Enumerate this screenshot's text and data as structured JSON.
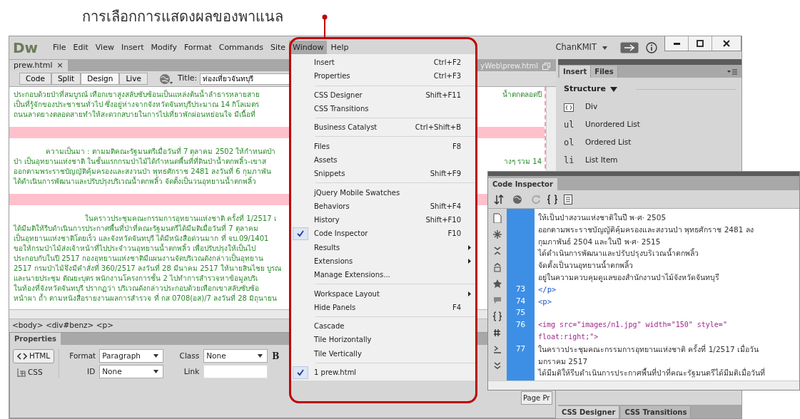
{
  "caption": "การเลือกการแสดงผลของพาแนล",
  "app": {
    "logo": "Dw",
    "user": "ChanKMIT",
    "menus": [
      {
        "label": "File",
        "selected": false
      },
      {
        "label": "Edit",
        "selected": false
      },
      {
        "label": "View",
        "selected": false
      },
      {
        "label": "Insert",
        "selected": false
      },
      {
        "label": "Modify",
        "selected": false
      },
      {
        "label": "Format",
        "selected": false
      },
      {
        "label": "Commands",
        "selected": false
      },
      {
        "label": "Site",
        "selected": false
      },
      {
        "label": "Window",
        "selected": true
      },
      {
        "label": "Help",
        "selected": false
      }
    ]
  },
  "document": {
    "tab": "prew.html",
    "tab_close": "×",
    "path": "yWeb\\prew.html",
    "views": [
      {
        "label": "Code",
        "selected": false
      },
      {
        "label": "Split",
        "selected": false
      },
      {
        "label": "Design",
        "selected": true
      },
      {
        "label": "Live",
        "selected": false
      }
    ],
    "title_label": "Title:",
    "title_value": "ท่องเที่ยวจันทบุรี"
  },
  "design_view": {
    "blocks": [
      {
        "kind": "paragraph",
        "lines": [
          {
            "kind": "plain",
            "text": "ประกอบด้วยป่าที่สมบูรณ์ เทือกเขาสูงสลับซับซ้อนเป็นแหล่งต้นน้ำลำธารหลายสาย",
            "right": "น้ำตกตลอดปี"
          },
          {
            "kind": "plain",
            "text": "เป็นที่รู้จักของประชาชนทั่วไป ซึ่งอยู่ห่างจากจังหวัดจันทบุรีประมาณ 14 กิโลเมตร"
          },
          {
            "kind": "plain",
            "text": "ถนนลาดยางตลอดสายทำให้สะดวกสบายในการไปเที่ยวพักผ่อนหย่อนใจ มีเนื้อที่"
          }
        ]
      },
      {
        "kind": "spacer"
      },
      {
        "kind": "paragraph",
        "lines": [
          {
            "kind": "indent",
            "text": "ความเป็นมา : ตามมติคณะรัฐมนตรีเมื่อวันที่ 7 ตุลาคม 2502 ให้กำหนดป่า"
          },
          {
            "kind": "plain",
            "text": "ป่า เป็นอุทยานแห่งชาติ ในชั้นแรกกรมป่าไม้ได้กำหนดพื้นที่ที่ดินป่าน้ำตกพลิ้ว-เขาส",
            "right": "างๆ รวม 14"
          },
          {
            "kind": "plain",
            "text": "ออกตามพระราชบัญญัติคุ้มครองและสงวนป่า พุทธศักราช 2481 ลงวันที่ 6 กุมภาพัน"
          },
          {
            "kind": "plain",
            "text": "ได้ดำเนินการพัฒนาและปรับปรุงบริเวณน้ำตกพลิ้ว จัดตั้งเป็นวนอุทยานน้ำตกพลิ้ว"
          }
        ]
      },
      {
        "kind": "spacer"
      },
      {
        "kind": "paragraph",
        "lines": [
          {
            "kind": "deep_indent",
            "text": "ในคราวประชุมคณะกรรมการอุทยานแห่งชาติ ครั้งที่ 1/2517 เ"
          },
          {
            "kind": "plain",
            "text": "ได้มีมติให้รีบดำเนินการประกาศพื้นที่ป่าที่คณะรัฐมนตรีได้มีมติเมื่อวันที่ 7 ตุลาคม"
          },
          {
            "kind": "plain",
            "text": "เป็นอุทยานแห่งชาติโดยเร็ว และจังหวัดจันทบุรี ได้มีหนังสือด่วนมาก ที่ จบ.09/1401"
          },
          {
            "kind": "plain",
            "text": "ขอให้กรมป่าไม้ส่งเจ้าหน้าที่ไปประจำวนอุทยานน้ำตกพลิ้ว เพื่อปรับปรุงให้เป็นไป"
          },
          {
            "kind": "plain",
            "text": "ประกอบกับในปี 2517 กองอุทยานแห่งชาติมีแผนงานจัดบริเวณดังกล่าวเป็นอุทยาน"
          },
          {
            "kind": "plain",
            "text": "2517 กรมป่าไม้จึงมีคำสั่งที่ 360/2517 ลงวันที่ 28 มีนาคม 2517 ให้นายสินไชย บูรณ"
          },
          {
            "kind": "plain",
            "text": "และนายประชุม ตัณยะบุตร พนักงานโครงการชั้น 2 ไปทำการสำรวจหาข้อมูลบริเ"
          },
          {
            "kind": "plain",
            "text": "ในท้องที่จังหวัดจันทบุรี ปรากฏว่า บริเวณดังกล่าวประกอบด้วยเทือกเขาสลับซับซ้อ"
          },
          {
            "kind": "plain",
            "text": "หน้าผา ถ้ำ ตามหนังสือรายงานผลการสำรวจ ที่ กส 0708(อส)/7 ลงวันที่ 28 มิถุนายน"
          }
        ]
      },
      {
        "kind": "spacer"
      }
    ]
  },
  "tag_selector": "<body> <div#benz> <p>",
  "properties": {
    "tab": "Properties",
    "modes": [
      {
        "label": "HTML",
        "selected": true
      },
      {
        "label": "CSS",
        "selected": false
      }
    ],
    "fields": [
      {
        "label": "Format",
        "value": "Paragraph",
        "kind": "select"
      },
      {
        "label": "Class",
        "value": "None",
        "kind": "select"
      },
      {
        "label": "ID",
        "value": "None",
        "kind": "select"
      },
      {
        "label": "Link",
        "kind": "input"
      }
    ],
    "bold": "B",
    "page_button": "Page Pr"
  },
  "window_menu": {
    "groups": [
      [
        {
          "label": "Insert",
          "shortcut": "Ctrl+F2",
          "checked": false,
          "submenu": false
        },
        {
          "label": "Properties",
          "shortcut": "Ctrl+F3",
          "checked": false,
          "submenu": false
        }
      ],
      [
        {
          "label": "CSS Designer",
          "shortcut": "Shift+F11",
          "checked": false,
          "submenu": false
        },
        {
          "label": "CSS Transitions",
          "checked": false,
          "submenu": false
        }
      ],
      [
        {
          "label": "Business Catalyst",
          "shortcut": "Ctrl+Shift+B",
          "checked": false,
          "submenu": false
        }
      ],
      [
        {
          "label": "Files",
          "shortcut": "F8",
          "checked": false,
          "submenu": false
        },
        {
          "label": "Assets",
          "checked": false,
          "submenu": false
        },
        {
          "label": "Snippets",
          "shortcut": "Shift+F9",
          "checked": false,
          "submenu": false
        }
      ],
      [
        {
          "label": "jQuery Mobile Swatches",
          "checked": false,
          "submenu": false
        },
        {
          "label": "Behaviors",
          "shortcut": "Shift+F4",
          "checked": false,
          "submenu": false
        },
        {
          "label": "History",
          "shortcut": "Shift+F10",
          "checked": false,
          "submenu": false
        },
        {
          "label": "Code Inspector",
          "shortcut": "F10",
          "checked": true,
          "submenu": false
        },
        {
          "label": "Results",
          "checked": false,
          "submenu": true
        },
        {
          "label": "Extensions",
          "checked": false,
          "submenu": true
        },
        {
          "label": "Manage Extensions...",
          "checked": false,
          "submenu": false
        }
      ],
      [
        {
          "label": "Workspace Layout",
          "checked": false,
          "submenu": true
        },
        {
          "label": "Hide Panels",
          "shortcut": "F4",
          "checked": false,
          "submenu": false
        }
      ],
      [
        {
          "label": "Cascade",
          "checked": false,
          "submenu": false
        },
        {
          "label": "Tile Horizontally",
          "checked": false,
          "submenu": false
        },
        {
          "label": "Tile Vertically",
          "checked": false,
          "submenu": false
        }
      ],
      [
        {
          "label": "1 prew.html",
          "checked": true,
          "submenu": false
        }
      ]
    ]
  },
  "insert_panel": {
    "tabs": [
      {
        "label": "Insert",
        "selected": true
      },
      {
        "label": "Files",
        "selected": false
      }
    ],
    "category": "Structure",
    "items": [
      {
        "kind": "icon",
        "label": "Div"
      },
      {
        "kind": "glyph",
        "glyph": "ul",
        "label": "Unordered List"
      },
      {
        "kind": "glyph",
        "glyph": "ol",
        "label": "Ordered List"
      },
      {
        "kind": "glyph",
        "glyph": "li",
        "label": "List Item"
      }
    ],
    "bottom_tabs": [
      {
        "label": "CSS Designer",
        "selected": true
      },
      {
        "label": "CSS Transitions",
        "selected": false
      }
    ]
  },
  "code_inspector": {
    "title": "Code Inspector",
    "lines": [
      {
        "kind": "text",
        "text": "ให้เป็นป่าสงวนแห่งชาติในปี พ·ศ· 2505"
      },
      {
        "kind": "text",
        "text": "ออกตามพระราชบัญญัติคุ้มครองและสงวนป่า พุทธศักราช 2481 ลง"
      },
      {
        "kind": "text",
        "text": "กุมภาพันธ์ 2504 และในปี พ·ศ· 2515"
      },
      {
        "kind": "text",
        "text": "ได้ดำเนินการพัฒนาและปรับปรุงบริเวณน้ำตกพลิ้ว"
      },
      {
        "kind": "text",
        "text": "จัดตั้งเป็นวนอุทยานน้ำตกพลิ้ว"
      },
      {
        "kind": "text",
        "text": "อยู่ในความควบคุมดูแลของสำนักงานป่าไม้จังหวัดจันทบุรี"
      },
      {
        "number": "73",
        "kind": "tag",
        "text": "</p>"
      },
      {
        "number": "74",
        "kind": "tag",
        "text": "<p>"
      },
      {
        "number": "75",
        "kind": "text"
      },
      {
        "number": "76",
        "kind": "element",
        "text": "<img src=\"images/n1.jpg\" width=\"150\" style=\""
      },
      {
        "kind": "element",
        "text": "float:right;\">"
      },
      {
        "number": "77",
        "kind": "text",
        "text": "ในคราวประชุมคณะกรรมการอุทยานแห่งชาติ ครั้งที่ 1/2517 เมื่อวัน"
      },
      {
        "kind": "text",
        "text": "มกราคม 2517"
      },
      {
        "kind": "text",
        "text": "ได้มีมติให้รีบดำเนินการประกาศพื้นที่ป่าที่คณะรัฐมนตรีได้มีมติเมื่อวันที่"
      }
    ]
  }
}
